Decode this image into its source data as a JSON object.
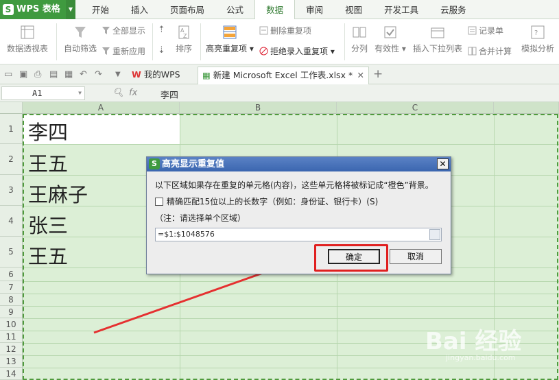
{
  "app": {
    "name": "WPS 表格",
    "badge": "S"
  },
  "menu_tabs": [
    "开始",
    "插入",
    "页面布局",
    "公式",
    "数据",
    "审阅",
    "视图",
    "开发工具",
    "云服务"
  ],
  "active_tab": "数据",
  "ribbon": {
    "pivot": "数据透视表",
    "autofilter": "自动筛选",
    "show_all": "全部显示",
    "reapply": "重新应用",
    "sort": "排序",
    "highlight_dup": "高亮重复项",
    "remove_dup": "删除重复项",
    "reject_dup": "拒绝录入重复项",
    "split": "分列",
    "validity": "有效性",
    "insert_dropdown": "插入下拉列表",
    "record_form": "记录单",
    "consolidate": "合并计算",
    "simulate": "模拟分析"
  },
  "doc_tabs": {
    "mywps": "我的WPS",
    "file": "新建 Microsoft Excel 工作表.xlsx *"
  },
  "formula_bar": {
    "cell_ref": "A1",
    "fx": "fx",
    "content": "李四"
  },
  "columns": [
    "A",
    "B",
    "C"
  ],
  "rows": [
    "1",
    "2",
    "3",
    "4",
    "5",
    "6",
    "7",
    "8",
    "9",
    "10",
    "11",
    "12",
    "13",
    "14"
  ],
  "cells": [
    "李四",
    "王五",
    "王麻子",
    "张三",
    "王五"
  ],
  "dialog": {
    "title": "高亮显示重复值",
    "close": "✕",
    "description": "以下区域如果存在重复的单元格(内容)，这些单元格将被标记成“橙色”背景。",
    "checkbox_label": "精确匹配15位以上的长数字（例如：身份证、银行卡）(S)",
    "note": "（注：请选择单个区域）",
    "range": "=$1:$1048576",
    "ok": "确定",
    "cancel": "取消"
  },
  "watermark": {
    "main": "Bai 经验",
    "sub": "jingyan.baidu.com"
  },
  "colors": {
    "brand_green": "#3f9a3f",
    "highlight_red": "#e02020",
    "sheet_green": "#dcefd6"
  }
}
